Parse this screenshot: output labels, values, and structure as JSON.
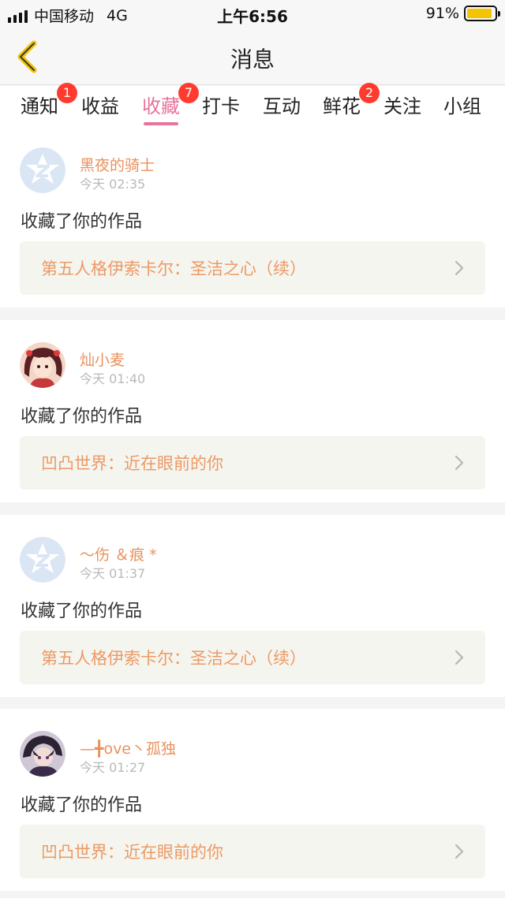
{
  "status_bar": {
    "carrier": "中国移动",
    "network": "4G",
    "time": "上午6:56",
    "battery_percent": "91%",
    "battery_level": 0.91,
    "battery_color": "#f5c400"
  },
  "nav": {
    "title": "消息",
    "back_icon": "chevron-left-icon",
    "back_color": "#f2c200"
  },
  "tabs": [
    {
      "label": "通知",
      "badge": "1",
      "active": false
    },
    {
      "label": "收益",
      "badge": "",
      "active": false
    },
    {
      "label": "收藏",
      "badge": "7",
      "active": true
    },
    {
      "label": "打卡",
      "badge": "",
      "active": false
    },
    {
      "label": "互动",
      "badge": "",
      "active": false
    },
    {
      "label": "鲜花",
      "badge": "2",
      "active": false
    },
    {
      "label": "关注",
      "badge": "",
      "active": false
    },
    {
      "label": "小组",
      "badge": "",
      "active": false
    }
  ],
  "colors": {
    "accent_pink": "#e8739b",
    "username_orange": "#e9915c",
    "badge_red": "#ff3b30"
  },
  "messages": [
    {
      "username": "黑夜的骑士",
      "time": "今天 02:35",
      "action": "收藏了你的作品",
      "work_title": "第五人格伊索卡尔：圣洁之心（续）",
      "avatar": "default-avatar"
    },
    {
      "username": "灿小麦",
      "time": "今天 01:40",
      "action": "收藏了你的作品",
      "work_title": "凹凸世界：近在眼前的你",
      "avatar": "anime-girl-avatar"
    },
    {
      "username": "～伤 ＆痕 *",
      "time": "今天 01:37",
      "action": "收藏了你的作品",
      "work_title": "第五人格伊索卡尔：圣洁之心（续）",
      "avatar": "default-avatar"
    },
    {
      "username": "—╋ove丶孤独",
      "time": "今天 01:27",
      "action": "收藏了你的作品",
      "work_title": "凹凸世界：近在眼前的你",
      "avatar": "anime-boy-avatar"
    }
  ]
}
